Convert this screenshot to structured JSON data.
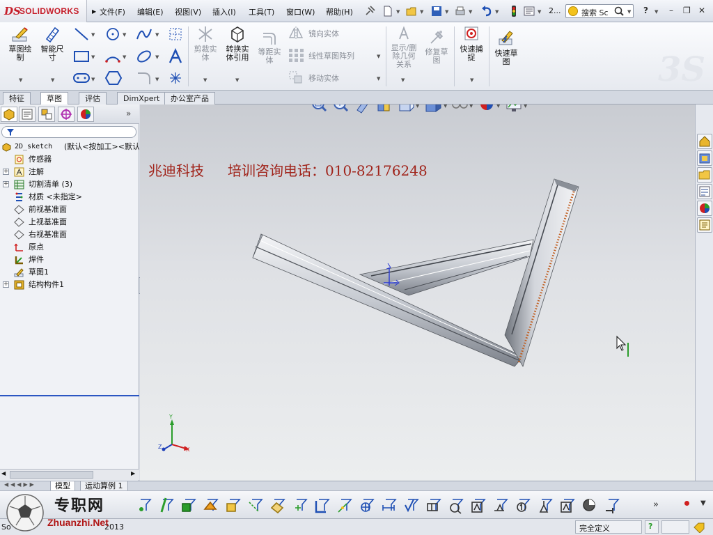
{
  "app": {
    "logo_text": "SOLIDWORKS",
    "logo_mark": "DS"
  },
  "menu": [
    "文件(F)",
    "编辑(E)",
    "视图(V)",
    "插入(I)",
    "工具(T)",
    "窗口(W)",
    "帮助(H)"
  ],
  "quick_access": {
    "overflow": "2..."
  },
  "search": {
    "value": "搜索 Sc"
  },
  "help_label": "?",
  "ribbon": {
    "sketch_label": "草图绘\n制",
    "smart_dim_label": "智能尺\n寸",
    "trim_label": "剪裁实\n体",
    "convert_label": "转换实\n体引用",
    "offset_label": "等距实\n体",
    "mirror_label": "镜向实体",
    "linear_pattern_label": "线性草图阵列",
    "move_label": "移动实体",
    "display_relations_label": "显示/删\n除几何\n关系",
    "repair_label": "修复草\n图",
    "quick_snap_label": "快速捕\n捉",
    "rapid_sketch_label": "快速草\n图"
  },
  "tabs": [
    {
      "label": "特征",
      "active": false
    },
    {
      "label": "草图",
      "active": true
    },
    {
      "label": "评估",
      "active": false
    },
    {
      "label": "DimXpert",
      "active": false
    },
    {
      "label": "办公室产品",
      "active": false
    }
  ],
  "feature_tree": {
    "root": {
      "name": "2D_sketch",
      "config": "(默认<按加工><默认"
    },
    "items": [
      {
        "label": "传感器",
        "icon": "sensor-icon",
        "expandable": false
      },
      {
        "label": "注解",
        "icon": "annotation-icon",
        "expandable": true
      },
      {
        "label": "切割清单 (3)",
        "icon": "cut-list-icon",
        "expandable": true
      },
      {
        "label": "材质 <未指定>",
        "icon": "material-icon",
        "expandable": false
      },
      {
        "label": "前视基准面",
        "icon": "plane-icon",
        "expandable": false
      },
      {
        "label": "上视基准面",
        "icon": "plane-icon",
        "expandable": false
      },
      {
        "label": "右视基准面",
        "icon": "plane-icon",
        "expandable": false
      },
      {
        "label": "原点",
        "icon": "origin-icon",
        "expandable": false
      },
      {
        "label": "焊件",
        "icon": "weldment-icon",
        "expandable": false
      },
      {
        "label": "草图1",
        "icon": "sketch-icon",
        "expandable": false
      },
      {
        "label": "结构构件1",
        "icon": "structural-member-icon",
        "expandable": true
      }
    ]
  },
  "viewport": {
    "watermark_company": "兆迪科技",
    "watermark_phone": "培训咨询电话：010-82176248",
    "triad": {
      "x": "X",
      "y": "Y",
      "z": "Z"
    }
  },
  "bottom_tabs": [
    "模型",
    "运动算例 1"
  ],
  "status": {
    "app_prefix": "So",
    "version": "2013",
    "state": "完全定义"
  },
  "site_logo": {
    "cn": "专职网",
    "en": "Zhuanzhi.Net"
  },
  "colors": {
    "accent": "#2b56c2",
    "watermark": "#a0231a",
    "brand_red": "#c61e2a"
  }
}
